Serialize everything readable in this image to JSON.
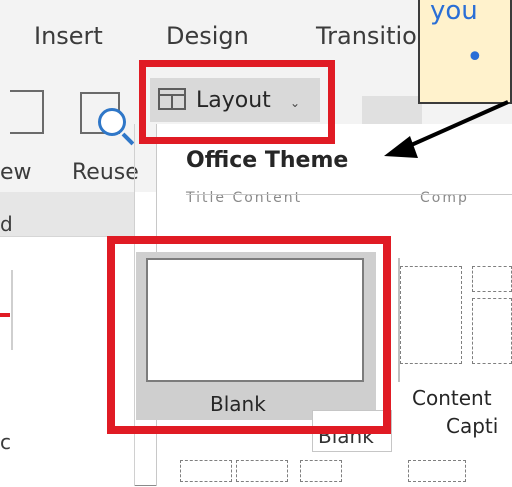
{
  "ribbon": {
    "tabs": [
      "Insert",
      "Design",
      "Transitio"
    ],
    "buttons": {
      "new_label": "ew",
      "new_sub": "d",
      "reuse_label": "Reuse",
      "layout_label": "Layout"
    }
  },
  "dropdown": {
    "section_title": "Office Theme",
    "cut_captions": [
      "Title Content",
      "Comp"
    ],
    "blank_caption": "Blank",
    "content_caption_line1": "Content",
    "content_caption_line2": "Capti"
  },
  "tooltip": {
    "text": "Blank"
  },
  "callout": {
    "text": "you",
    "bullet": "•"
  },
  "left_panel": {
    "cut_text": "d",
    "cut_text_bottom": "c"
  },
  "icons": [
    "layout-icon",
    "chevron-down-icon",
    "new-slide-icon",
    "reuse-slides-icon"
  ],
  "colors": {
    "highlight_red": "#e01b24",
    "callout_bg": "#fff2cc",
    "callout_text": "#2a6fd6",
    "ribbon_bg": "#f3f3f3"
  }
}
